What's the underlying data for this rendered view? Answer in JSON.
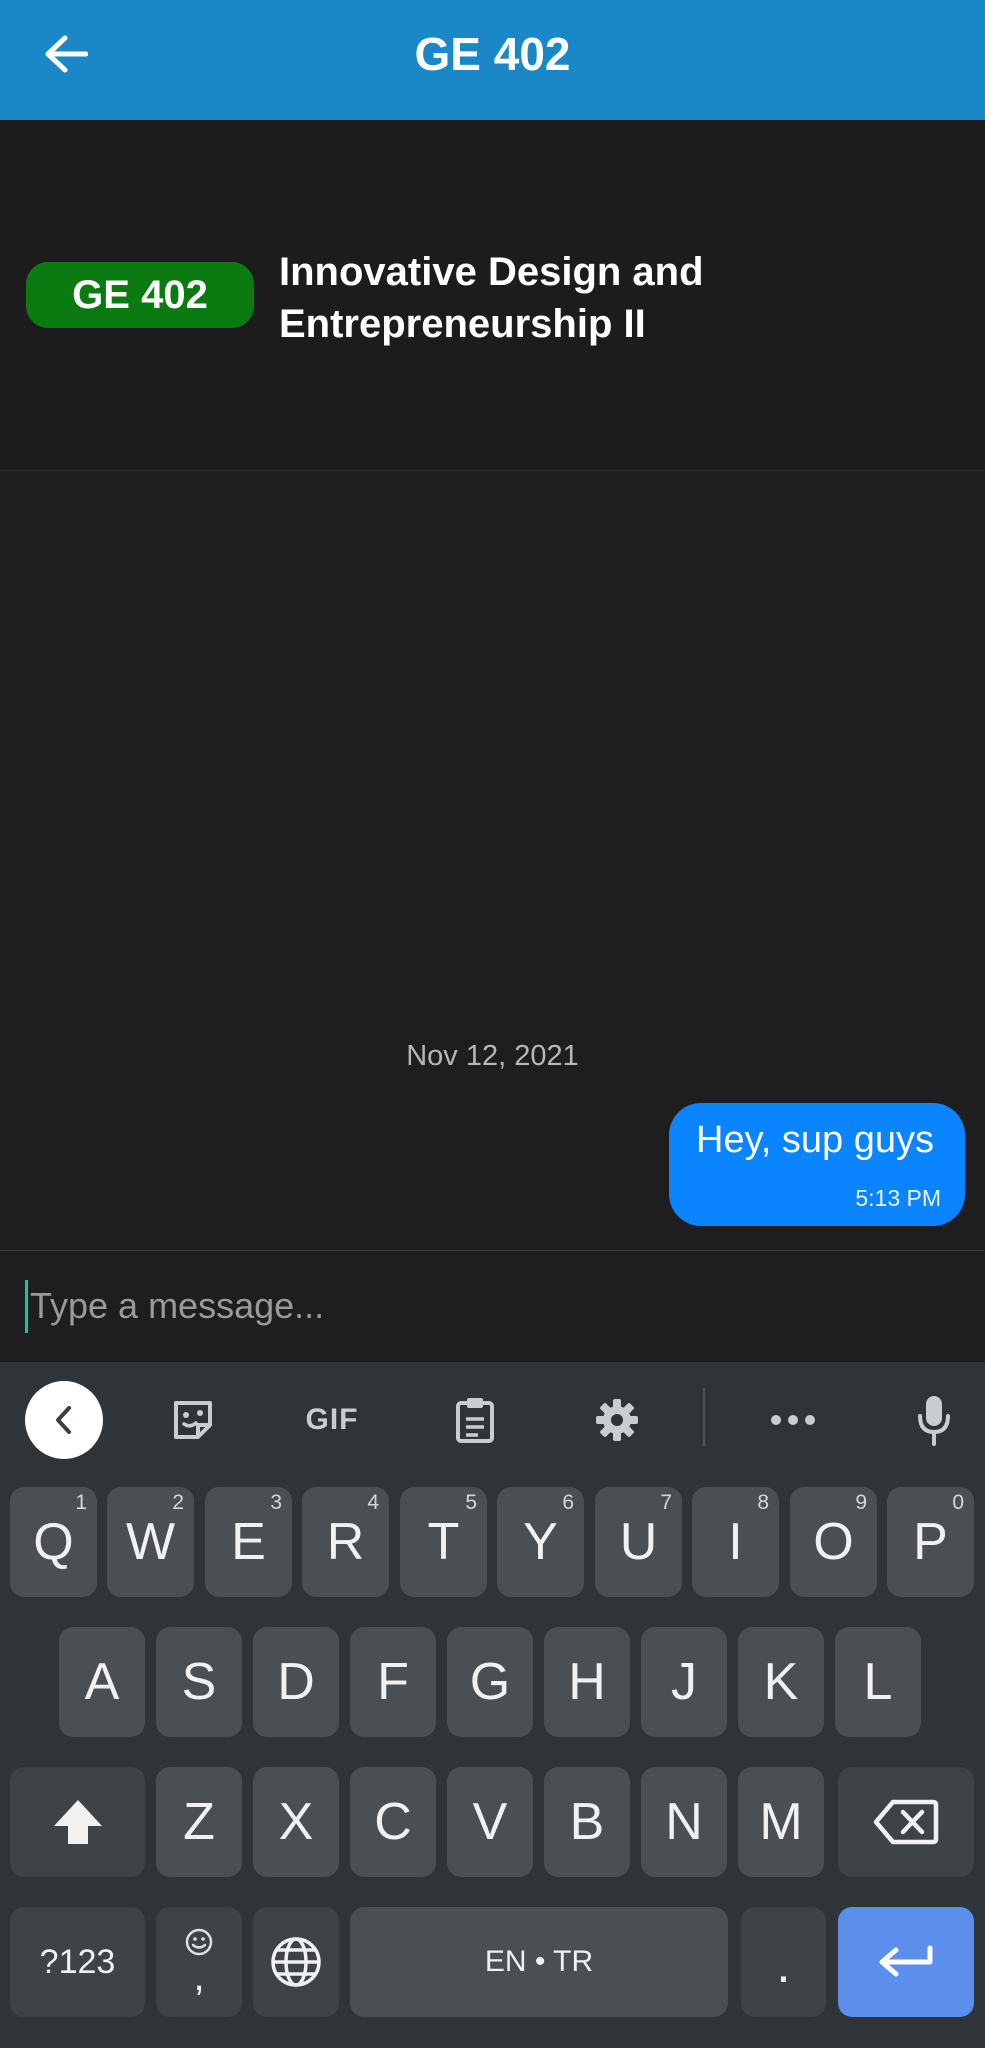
{
  "header": {
    "title": "GE 402"
  },
  "course": {
    "code": "GE 402",
    "name_line1": "Innovative Design and",
    "name_line2": "Entrepreneurship II",
    "badge_color": "#0b7a10"
  },
  "chat": {
    "date_separator": "Nov 12, 2021",
    "messages": [
      {
        "text": "Hey, sup guys",
        "time": "5:13 PM",
        "sender": "me"
      }
    ]
  },
  "composer": {
    "placeholder": "Type a message..."
  },
  "keyboard": {
    "toolbar": {
      "gif_label": "GIF",
      "icons": [
        "chevron-left-icon",
        "sticker-icon",
        "gif-icon",
        "clipboard-icon",
        "gear-icon",
        "more-icon",
        "microphone-icon"
      ]
    },
    "row1": [
      {
        "label": "Q",
        "hint": "1"
      },
      {
        "label": "W",
        "hint": "2"
      },
      {
        "label": "E",
        "hint": "3"
      },
      {
        "label": "R",
        "hint": "4"
      },
      {
        "label": "T",
        "hint": "5"
      },
      {
        "label": "Y",
        "hint": "6"
      },
      {
        "label": "U",
        "hint": "7"
      },
      {
        "label": "I",
        "hint": "8"
      },
      {
        "label": "O",
        "hint": "9"
      },
      {
        "label": "P",
        "hint": "0"
      }
    ],
    "row2": [
      "A",
      "S",
      "D",
      "F",
      "G",
      "H",
      "J",
      "K",
      "L"
    ],
    "row3": [
      "Z",
      "X",
      "C",
      "V",
      "B",
      "N",
      "M"
    ],
    "row4": {
      "symbols": "?123",
      "comma": ",",
      "space": "EN • TR",
      "period": "."
    }
  },
  "colors": {
    "header": "#1a87c7",
    "bubble": "#0a84ff",
    "enter_key": "#5c8fec"
  }
}
